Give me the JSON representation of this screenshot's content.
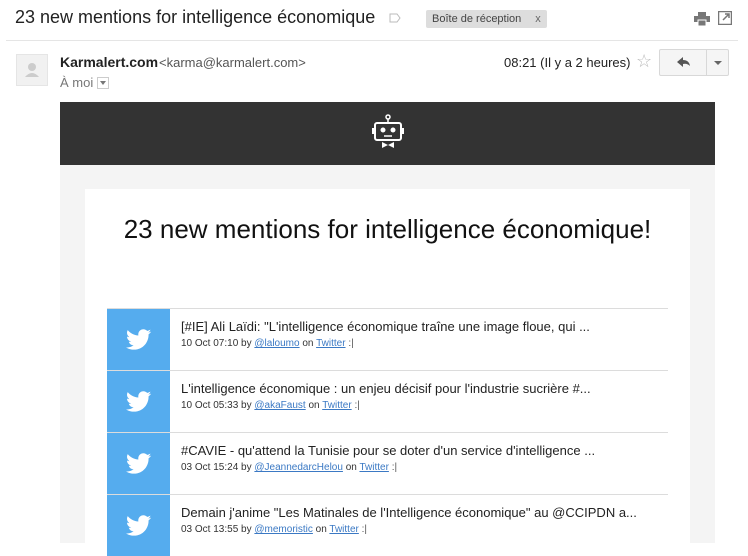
{
  "subject": "23 new mentions for intelligence économique",
  "label": {
    "text": "Boîte de réception",
    "close": "x"
  },
  "sender": {
    "name": "Karmalert.com",
    "email": "<karma@karmalert.com>"
  },
  "recipient": "À moi",
  "timestamp": "08:21 (Il y a 2 heures)",
  "body": {
    "title": "23 new mentions for intelligence économique!",
    "mentions": [
      {
        "text": "[#IE] Ali Laïdi: \"L'intelligence économique traîne une image floue, qui ...",
        "date": "10 Oct 07:10",
        "by": "by",
        "user": "@laloumo",
        "on": "on",
        "source": "Twitter",
        "sep": ":|"
      },
      {
        "text": "L'intelligence économique : un enjeu décisif pour l'industrie sucrière #...",
        "date": "10 Oct 05:33",
        "by": "by",
        "user": "@akaFaust",
        "on": "on",
        "source": "Twitter",
        "sep": ":|"
      },
      {
        "text": "#CAVIE - qu'attend la Tunisie pour se doter d'un service d'intelligence ...",
        "date": "03 Oct 15:24",
        "by": "by",
        "user": "@JeannedarcHelou",
        "on": "on",
        "source": "Twitter",
        "sep": ":|"
      },
      {
        "text": "Demain j'anime \"Les Matinales de l'Intelligence économique\" au @CCIPDN a...",
        "date": "03 Oct 13:55",
        "by": "by",
        "user": "@memoristic",
        "on": "on",
        "source": "Twitter",
        "sep": ":|"
      }
    ]
  },
  "colors": {
    "header": "#333333",
    "twitter": "#55acee",
    "link": "#3b79c4"
  }
}
